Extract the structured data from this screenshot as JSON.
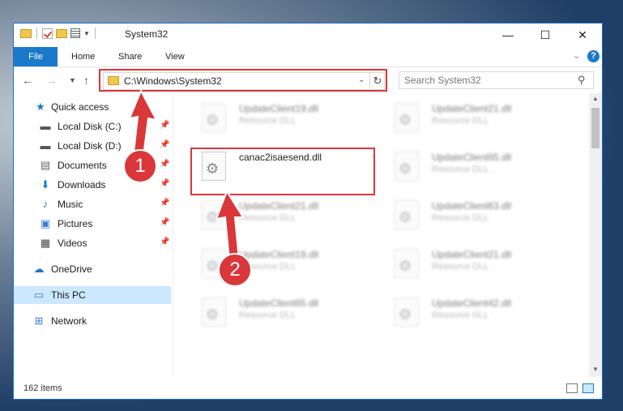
{
  "window": {
    "title": "System32"
  },
  "ribbon": {
    "tabs": [
      "File",
      "Home",
      "Share",
      "View"
    ],
    "help": "?"
  },
  "address": {
    "path": "C:\\Windows\\System32"
  },
  "search": {
    "placeholder": "Search System32"
  },
  "sidebar": {
    "items": [
      {
        "label": "Quick access",
        "icon": "star-icon",
        "color": "#1979ca"
      },
      {
        "label": "Local Disk (C:)",
        "icon": "drive-icon",
        "color": "#555555"
      },
      {
        "label": "Local Disk (D:)",
        "icon": "drive-icon",
        "color": "#555555"
      },
      {
        "label": "Documents",
        "icon": "documents-icon",
        "color": "#666666"
      },
      {
        "label": "Downloads",
        "icon": "download-icon",
        "color": "#1979ca"
      },
      {
        "label": "Music",
        "icon": "music-icon",
        "color": "#1979ca"
      },
      {
        "label": "Pictures",
        "icon": "pictures-icon",
        "color": "#3a7bd5"
      },
      {
        "label": "Videos",
        "icon": "videos-icon",
        "color": "#444444"
      },
      {
        "label": "OneDrive",
        "icon": "cloud-icon",
        "color": "#1979ca"
      },
      {
        "label": "This PC",
        "icon": "computer-icon",
        "color": "#3a7bd5"
      },
      {
        "label": "Network",
        "icon": "network-icon",
        "color": "#3a7bd5"
      }
    ]
  },
  "files": {
    "col1": [
      {
        "name": "UpdateClient19.dll",
        "type": "Resource DLL"
      },
      {
        "name": "canac2isaesend.dll",
        "type": ""
      },
      {
        "name": "UpdateClient21.dll",
        "type": "Resource DLL"
      },
      {
        "name": "UpdateClient19.dll",
        "type": "Resource DLL"
      },
      {
        "name": "UpdateClient65.dll",
        "type": "Resource DLL"
      }
    ],
    "col2": [
      {
        "name": "UpdateClient21.dll",
        "type": "Resource DLL"
      },
      {
        "name": "UpdateClient65.dll",
        "type": "Resource DLL"
      },
      {
        "name": "UpdateClient63.dll",
        "type": "Resource DLL"
      },
      {
        "name": "UpdateClient21.dll",
        "type": "Resource DLL"
      },
      {
        "name": "UpdateClient42.dll",
        "type": "Resource DLL"
      }
    ]
  },
  "status": {
    "item_count": "162 items"
  },
  "callouts": {
    "one": "1",
    "two": "2"
  },
  "colors": {
    "accent": "#1979ca",
    "highlight": "#d9373a",
    "selected": "#cce8ff"
  }
}
